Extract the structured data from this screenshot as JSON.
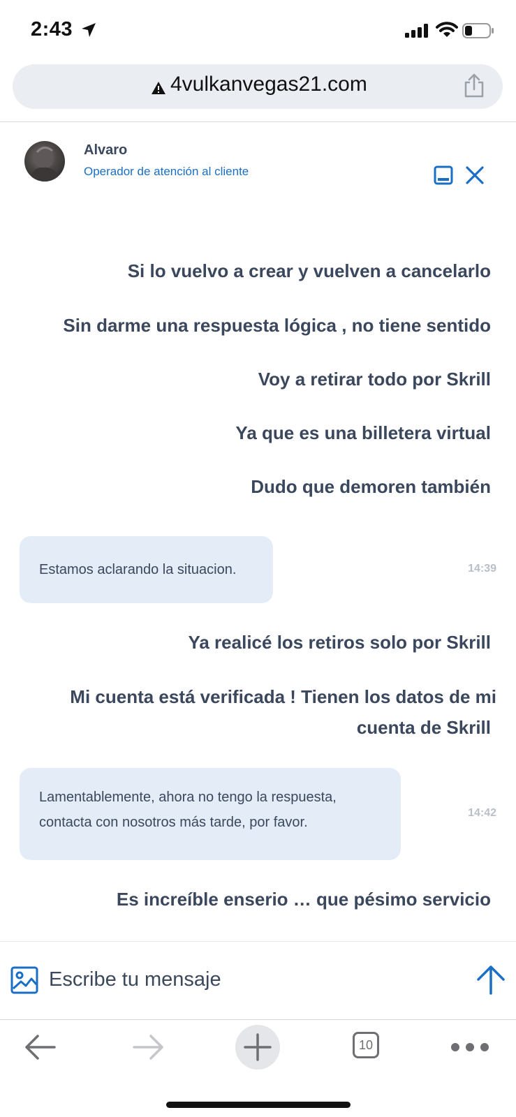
{
  "status_bar": {
    "time": "2:43",
    "icons": [
      "location-arrow-icon",
      "signal-icon",
      "wifi-icon",
      "battery-icon"
    ]
  },
  "browser": {
    "url": "4vulkanvegas21.com",
    "warning_icon": "warning-icon",
    "tabs_count": "10"
  },
  "chat": {
    "agent_name": "Alvaro",
    "agent_role": "Operador de atención al cliente",
    "messages": [
      {
        "from": "user",
        "text": "Si lo vuelvo a crear y vuelven a cancelarlo"
      },
      {
        "from": "user",
        "text": "Sin darme una respuesta lógica , no tiene sentido"
      },
      {
        "from": "user",
        "text": "Voy a retirar todo por Skrill"
      },
      {
        "from": "user",
        "text": "Ya que es una billetera virtual"
      },
      {
        "from": "user",
        "text": "Dudo que demoren también"
      },
      {
        "from": "operator",
        "text": "Estamos aclarando la situacion.",
        "time": "14:39"
      },
      {
        "from": "user",
        "text": "Ya realicé los retiros solo por Skrill"
      },
      {
        "from": "user",
        "lines": [
          "Mi cuenta está verificada ! Tienen los datos de mi",
          "cuenta de Skrill"
        ]
      },
      {
        "from": "operator",
        "lines": [
          "Lamentablemente, ahora no tengo la respuesta,",
          "contacta con nosotros más tarde, por favor."
        ],
        "time": "14:42"
      },
      {
        "from": "user",
        "text": "Es increíble enserio … que pésimo servicio"
      }
    ],
    "input_placeholder": "Escribe tu mensaje"
  },
  "colors": {
    "accent": "#1a6fc4",
    "text": "#3a475c",
    "operator_bubble": "#e4edf7",
    "timestamp": "#b9bfc8"
  }
}
